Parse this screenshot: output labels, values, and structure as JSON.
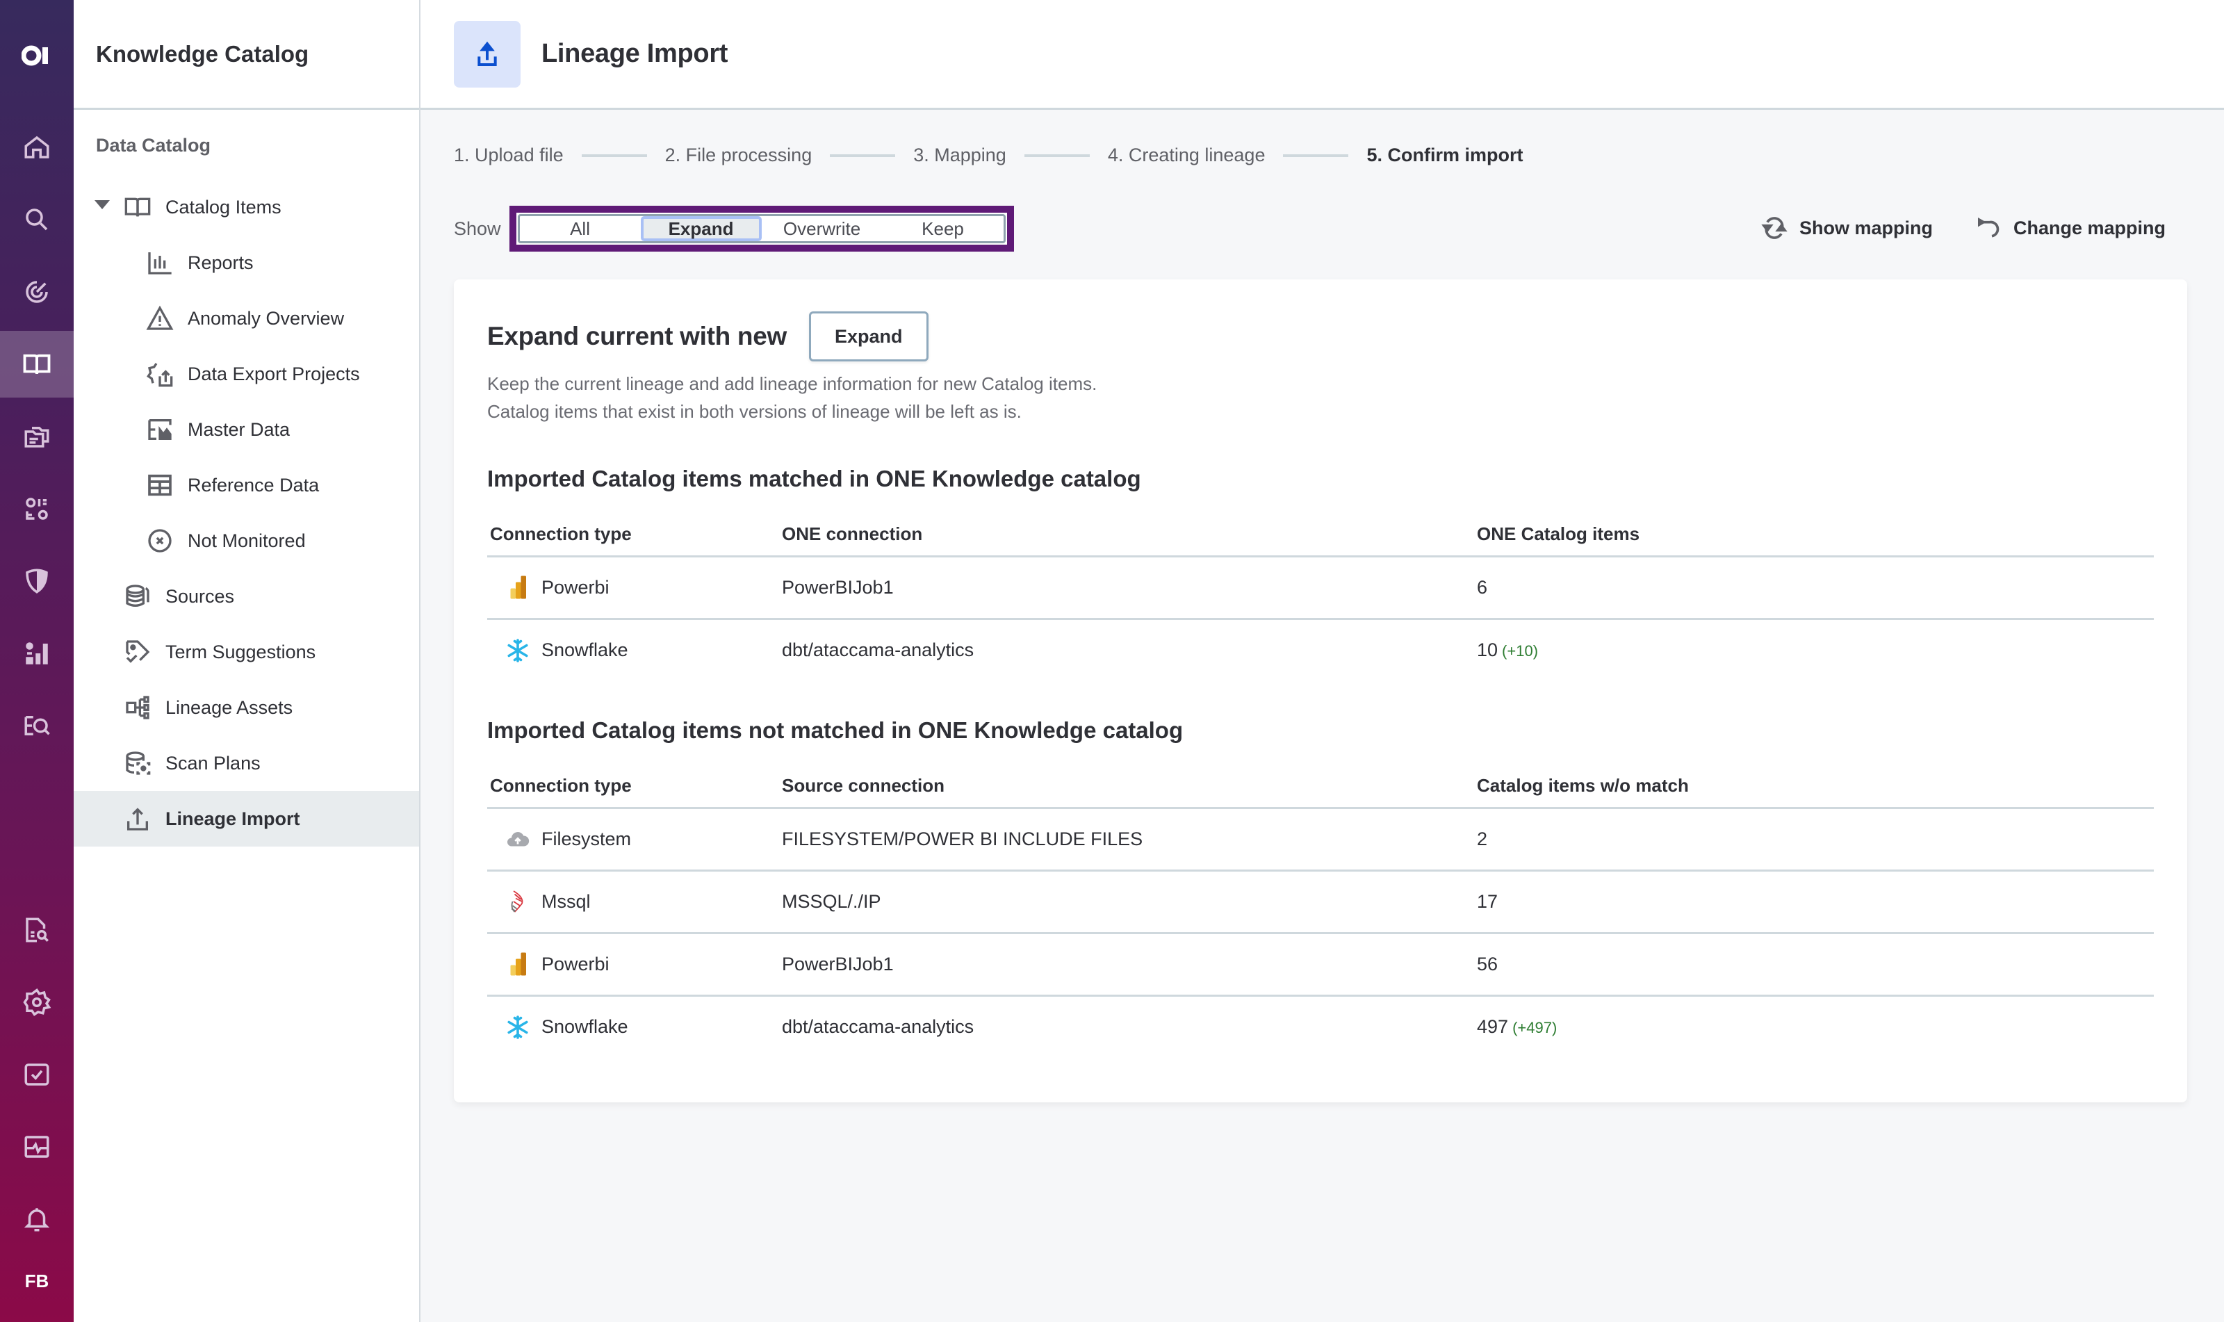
{
  "rail": {
    "logo": "logo-icon",
    "items": [
      {
        "icon": "home-icon",
        "active": false
      },
      {
        "icon": "search-icon",
        "active": false
      },
      {
        "icon": "radar-icon",
        "active": false
      },
      {
        "icon": "book-icon",
        "active": true
      },
      {
        "icon": "folder-icon",
        "active": false
      },
      {
        "icon": "dashboard-icon",
        "active": false
      },
      {
        "icon": "shield-icon",
        "active": false
      },
      {
        "icon": "analytics-icon",
        "active": false
      },
      {
        "icon": "data-quality-search-icon",
        "active": false
      },
      {
        "icon": "document-search-icon",
        "active": false
      },
      {
        "icon": "gear-icon",
        "active": false
      },
      {
        "icon": "task-check-icon",
        "active": false
      },
      {
        "icon": "monitor-pulse-icon",
        "active": false
      },
      {
        "icon": "bell-icon",
        "active": false
      }
    ],
    "user_initials": "FB"
  },
  "sidebar": {
    "title": "Knowledge Catalog",
    "section": "Data Catalog",
    "items": [
      {
        "label": "Catalog Items",
        "icon": "book-icon",
        "level": 1,
        "expanded": true
      },
      {
        "label": "Reports",
        "icon": "bar-chart-icon",
        "level": 2
      },
      {
        "label": "Anomaly Overview",
        "icon": "warning-icon",
        "level": 2
      },
      {
        "label": "Data Export Projects",
        "icon": "export-gear-icon",
        "level": 2
      },
      {
        "label": "Master Data",
        "icon": "master-data-icon",
        "level": 2
      },
      {
        "label": "Reference Data",
        "icon": "table-icon",
        "level": 2
      },
      {
        "label": "Not Monitored",
        "icon": "circle-x-icon",
        "level": 2
      },
      {
        "label": "Sources",
        "icon": "database-icon",
        "level": 1
      },
      {
        "label": "Term Suggestions",
        "icon": "tag-check-icon",
        "level": 1
      },
      {
        "label": "Lineage Assets",
        "icon": "lineage-icon",
        "level": 1
      },
      {
        "label": "Scan Plans",
        "icon": "scan-database-icon",
        "level": 1
      },
      {
        "label": "Lineage Import",
        "icon": "upload-icon",
        "level": 1,
        "active": true
      }
    ]
  },
  "header": {
    "title": "Lineage Import",
    "icon": "upload-icon"
  },
  "stepper": {
    "steps": [
      "1. Upload file",
      "2. File processing",
      "3. Mapping",
      "4. Creating lineage",
      "5. Confirm import"
    ],
    "current": 4
  },
  "filter": {
    "label": "Show",
    "options": [
      "All",
      "Expand",
      "Overwrite",
      "Keep"
    ],
    "selected": "Expand"
  },
  "actions": {
    "show_mapping": "Show mapping",
    "change_mapping": "Change mapping"
  },
  "card": {
    "title": "Expand current with new",
    "button_label": "Expand",
    "description_line1": "Keep the current lineage and add lineage information for new Catalog items.",
    "description_line2": "Catalog items that exist in both versions of lineage will be left as is.",
    "matched": {
      "title": "Imported Catalog items matched in ONE Knowledge catalog",
      "columns": [
        "Connection type",
        "ONE connection",
        "ONE Catalog items"
      ],
      "rows": [
        {
          "type": "Powerbi",
          "icon": "powerbi-icon",
          "connection": "PowerBIJob1",
          "count": "6",
          "delta": ""
        },
        {
          "type": "Snowflake",
          "icon": "snowflake-icon",
          "connection": "dbt/ataccama-analytics",
          "count": "10",
          "delta": "(+10)"
        }
      ]
    },
    "unmatched": {
      "title": "Imported Catalog items not matched in ONE Knowledge catalog",
      "columns": [
        "Connection type",
        "Source connection",
        "Catalog items w/o match"
      ],
      "rows": [
        {
          "type": "Filesystem",
          "icon": "cloud-upload-icon",
          "connection": "FILESYSTEM/POWER BI INCLUDE FILES",
          "count": "2",
          "delta": ""
        },
        {
          "type": "Mssql",
          "icon": "mssql-icon",
          "connection": "MSSQL/./IP",
          "count": "17",
          "delta": ""
        },
        {
          "type": "Powerbi",
          "icon": "powerbi-icon",
          "connection": "PowerBIJob1",
          "count": "56",
          "delta": ""
        },
        {
          "type": "Snowflake",
          "icon": "snowflake-icon",
          "connection": "dbt/ataccama-analytics",
          "count": "497",
          "delta": "(+497)"
        }
      ]
    }
  },
  "colors": {
    "accent_purple": "#5f1a77",
    "delta_green": "#2e7d32",
    "selected_segment_border": "#a9c0f5",
    "header_icon_bg": "#dbe4fb",
    "header_icon_fg": "#0b4fcf"
  }
}
